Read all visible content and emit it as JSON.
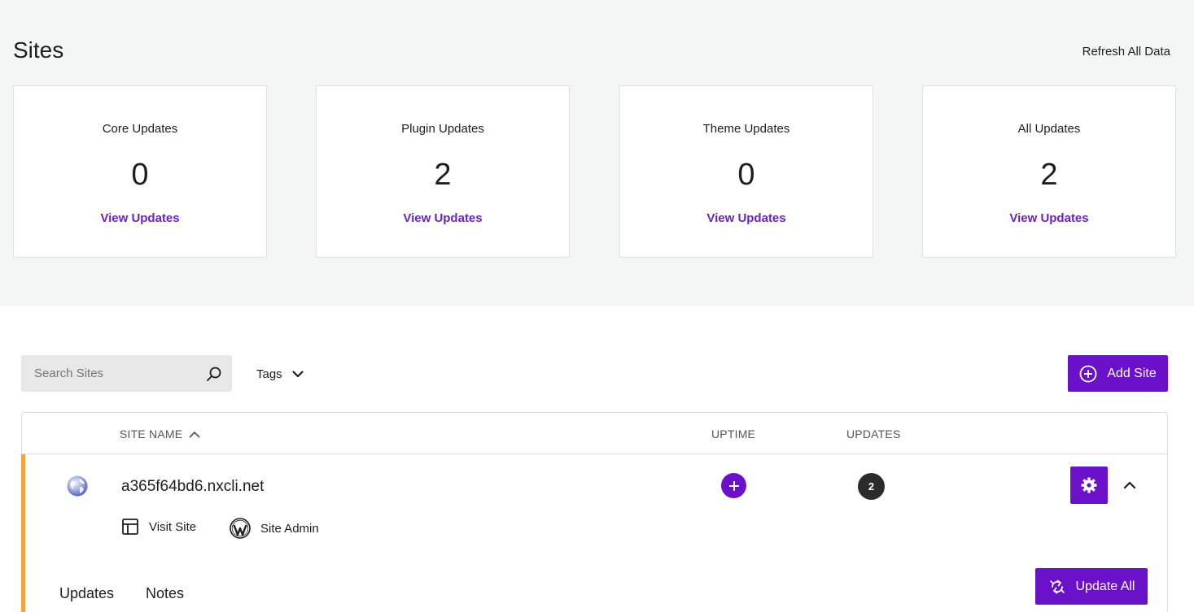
{
  "header": {
    "title": "Sites",
    "refresh_label": "Refresh All Data"
  },
  "cards": [
    {
      "title": "Core Updates",
      "count": "0",
      "link": "View Updates"
    },
    {
      "title": "Plugin Updates",
      "count": "2",
      "link": "View Updates"
    },
    {
      "title": "Theme Updates",
      "count": "0",
      "link": "View Updates"
    },
    {
      "title": "All Updates",
      "count": "2",
      "link": "View Updates"
    }
  ],
  "toolbar": {
    "search_placeholder": "Search Sites",
    "tags_label": "Tags",
    "add_site_label": "Add Site"
  },
  "table": {
    "columns": {
      "site_name": "SITE NAME",
      "uptime": "UPTIME",
      "updates": "UPDATES"
    },
    "rows": [
      {
        "site": "a365f64bd6.nxcli.net",
        "visit_label": "Visit Site",
        "admin_label": "Site Admin",
        "updates_count": "2",
        "status_color": "#f5a33a"
      }
    ]
  },
  "detail": {
    "tabs": [
      "Updates",
      "Notes"
    ],
    "update_all_label": "Update All"
  },
  "colors": {
    "accent": "#6b11c9",
    "link": "#6b21c8",
    "background_top": "#f4f5f5"
  }
}
